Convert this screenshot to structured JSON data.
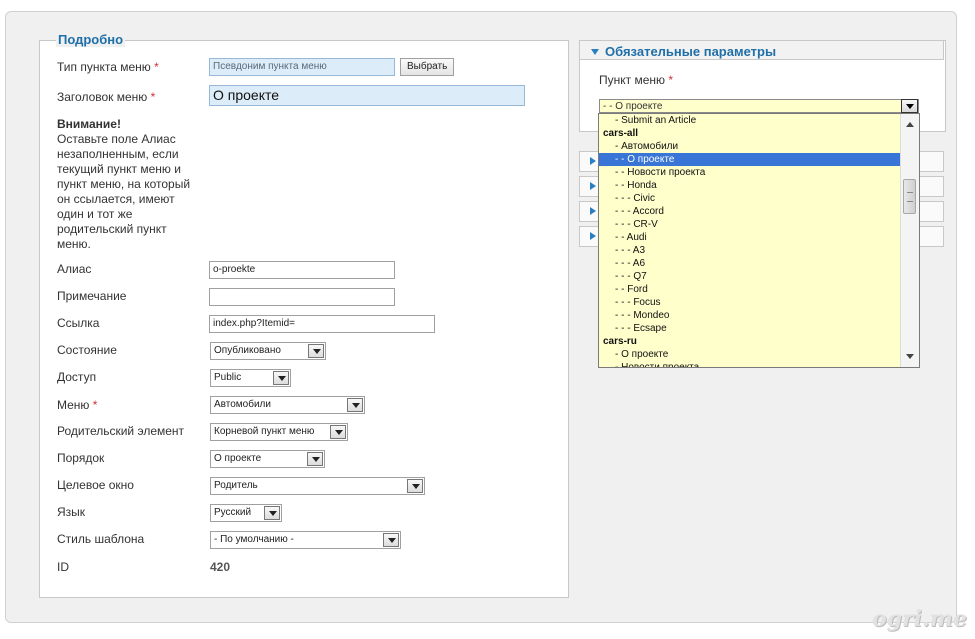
{
  "details": {
    "legend": "Подробно",
    "menu_type_label": "Тип пункта меню",
    "menu_type_value": "Псевдоним пункта меню",
    "select_button": "Выбрать",
    "title_label": "Заголовок меню",
    "title_value": "О проекте",
    "required_mark": "*",
    "note_head": "Внимание!",
    "note_lines": [
      "Оставьте поле Алиас",
      "незаполненным, если",
      "текущий пункт меню и",
      "пункт меню, на который",
      "он ссылается, имеют",
      "один и тот же",
      "родительский пункт",
      "меню."
    ],
    "alias_label": "Алиас",
    "alias_value": "o-proekte",
    "note_field_label": "Примечание",
    "note_field_value": "",
    "link_label": "Ссылка",
    "link_value": "index.php?Itemid=",
    "state_label": "Состояние",
    "state_value": "Опубликовано",
    "access_label": "Доступ",
    "access_value": "Public",
    "menu_label": "Меню",
    "menu_value": "Автомобили",
    "parent_label": "Родительский элемент",
    "parent_value": "Корневой пункт меню",
    "order_label": "Порядок",
    "order_value": "О проекте",
    "target_label": "Целевое окно",
    "target_value": "Родитель",
    "language_label": "Язык",
    "language_value": "Русский",
    "template_label": "Стиль шаблона",
    "template_value": "- По умолчанию -",
    "id_label": "ID",
    "id_value": "420"
  },
  "required_params": {
    "title": "Обязательные параметры",
    "menu_item_label": "Пункт меню",
    "menu_item_value": "- - О проекте",
    "options": [
      {
        "text": "- Submit an Article",
        "indent": 1
      },
      {
        "text": "cars-all",
        "group": true
      },
      {
        "text": "- Автомобили",
        "indent": 1
      },
      {
        "text": "- - О проекте",
        "indent": 1,
        "selected": true
      },
      {
        "text": "- - Новости проекта",
        "indent": 1
      },
      {
        "text": "- - Honda",
        "indent": 1
      },
      {
        "text": "- - - Civic",
        "indent": 1
      },
      {
        "text": "- - - Accord",
        "indent": 1
      },
      {
        "text": "- - - CR-V",
        "indent": 1
      },
      {
        "text": "- - Audi",
        "indent": 1
      },
      {
        "text": "- - - A3",
        "indent": 1
      },
      {
        "text": "- - - A6",
        "indent": 1
      },
      {
        "text": "- - - Q7",
        "indent": 1
      },
      {
        "text": "- - Ford",
        "indent": 1
      },
      {
        "text": "- - - Focus",
        "indent": 1
      },
      {
        "text": "- - - Mondeo",
        "indent": 1
      },
      {
        "text": "- - - Ecsape",
        "indent": 1
      },
      {
        "text": "cars-ru",
        "group": true
      },
      {
        "text": "- О проекте",
        "indent": 1
      },
      {
        "text": "- Новости проекта",
        "indent": 1
      }
    ]
  },
  "watermark": "ogri.me",
  "colors": {
    "accent": "#1f6fa8",
    "highlight": "#3875d7",
    "dropdown_bg": "#ffffcc",
    "input_blue": "#dcecf8"
  }
}
